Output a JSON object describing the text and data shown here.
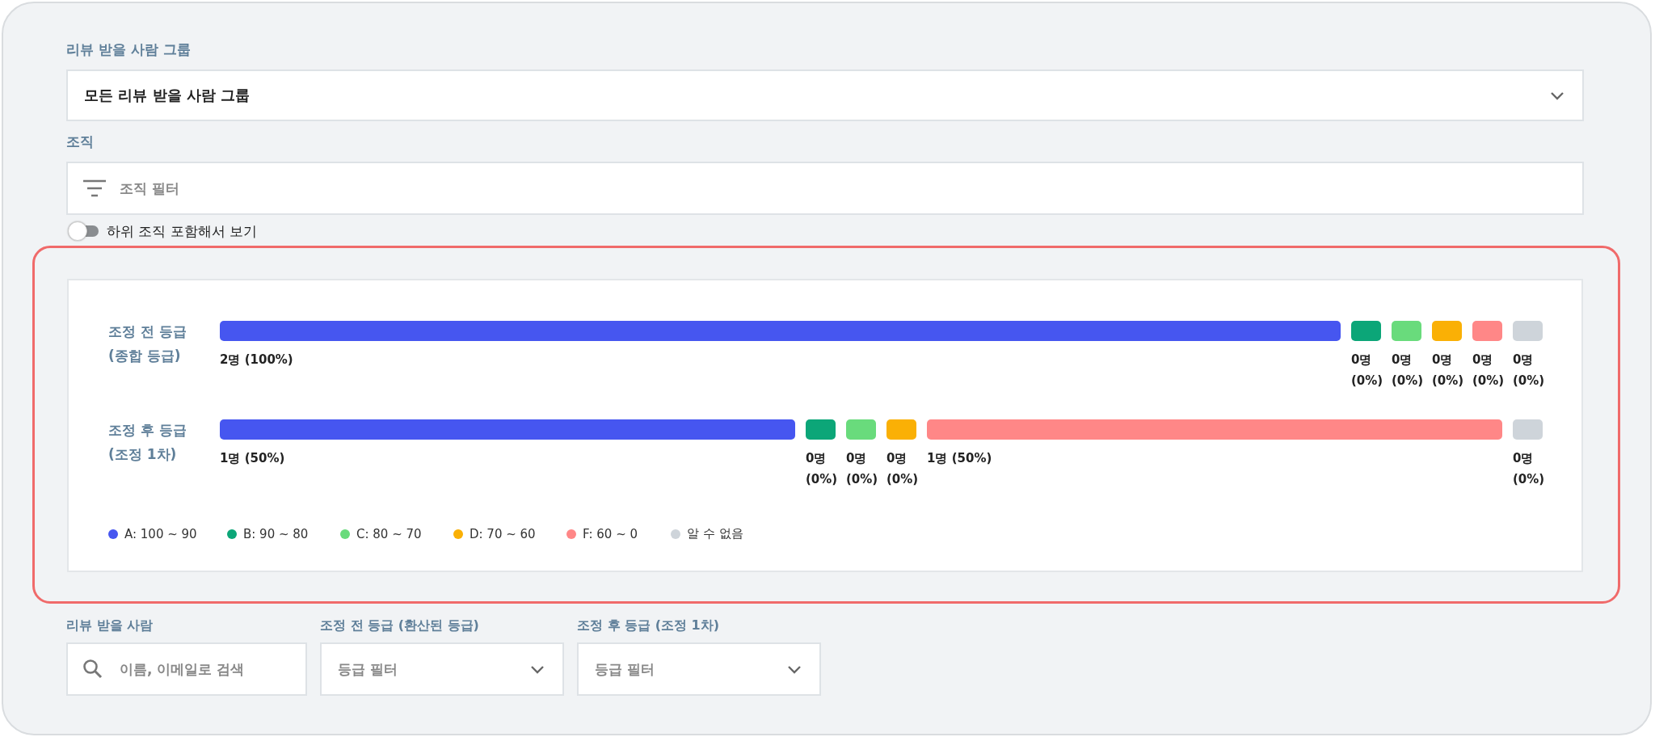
{
  "filters": {
    "group": {
      "label": "리뷰 받을 사람 그룹",
      "value": "모든 리뷰 받을 사람 그룹"
    },
    "organization": {
      "label": "조직",
      "placeholder": "조직 필터"
    },
    "include_sub": {
      "label": "하위 조직 포함해서 보기",
      "on": false
    }
  },
  "grade_rows": [
    {
      "label": "조정 전 등급 (종합 등급)",
      "segments": [
        {
          "color": "#4656f0",
          "kind": "wide",
          "text": "2명 (100%)"
        },
        {
          "color": "#0ca678",
          "kind": "narrow",
          "text": "0명 (0%)"
        },
        {
          "color": "#69db7c",
          "kind": "narrow",
          "text": "0명 (0%)"
        },
        {
          "color": "#fab005",
          "kind": "narrow",
          "text": "0명 (0%)"
        },
        {
          "color": "#ff8787",
          "kind": "narrow",
          "text": "0명 (0%)"
        },
        {
          "color": "#ced4da",
          "kind": "narrow",
          "text": "0명 (0%)"
        }
      ]
    },
    {
      "label": "조정 후 등급 (조정 1차)",
      "segments": [
        {
          "color": "#4656f0",
          "kind": "wide",
          "text": "1명 (50%)"
        },
        {
          "color": "#0ca678",
          "kind": "narrow",
          "text": "0명 (0%)"
        },
        {
          "color": "#69db7c",
          "kind": "narrow",
          "text": "0명 (0%)"
        },
        {
          "color": "#fab005",
          "kind": "narrow",
          "text": "0명 (0%)"
        },
        {
          "color": "#ff8787",
          "kind": "wide",
          "text": "1명 (50%)"
        },
        {
          "color": "#ced4da",
          "kind": "narrow",
          "text": "0명 (0%)"
        }
      ]
    }
  ],
  "legend": [
    {
      "label": "A: 100 ~ 90",
      "color": "#4656f0"
    },
    {
      "label": "B: 90 ~ 80",
      "color": "#0ca678"
    },
    {
      "label": "C: 80 ~ 70",
      "color": "#69db7c"
    },
    {
      "label": "D: 70 ~ 60",
      "color": "#fab005"
    },
    {
      "label": "F: 60 ~ 0",
      "color": "#ff8787"
    },
    {
      "label": "알 수 없음",
      "color": "#ced4da"
    }
  ],
  "reviewee_filters": [
    {
      "label": "리뷰 받을 사람",
      "kind": "search",
      "placeholder": "이름, 이메일로 검색"
    },
    {
      "label": "조정 전 등급 (환산된 등급)",
      "kind": "select",
      "placeholder": "등급 필터"
    },
    {
      "label": "조정 후 등급 (조정 1차)",
      "kind": "select",
      "placeholder": "등급 필터"
    }
  ]
}
